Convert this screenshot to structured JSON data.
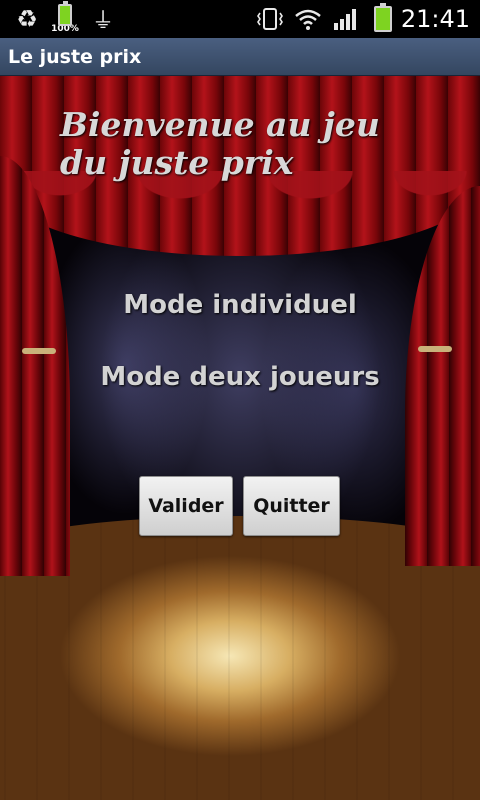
{
  "status_bar": {
    "icons": [
      "recycle-icon",
      "battery-charging-icon",
      "usb-icon",
      "vibrate-icon",
      "wifi-icon",
      "signal-icon",
      "battery-icon"
    ],
    "battery_percent_label": "100%",
    "time": "21:41",
    "battery_color": "#7ed321"
  },
  "app": {
    "title": "Le juste prix",
    "title_bar_color": "#3e5270"
  },
  "main": {
    "welcome_line1": "Bienvenue au jeu",
    "welcome_line2": "du juste prix",
    "modes": [
      {
        "label": "Mode individuel"
      },
      {
        "label": "Mode deux joueurs"
      }
    ],
    "buttons": {
      "validate_label": "Valider",
      "quit_label": "Quitter"
    }
  }
}
